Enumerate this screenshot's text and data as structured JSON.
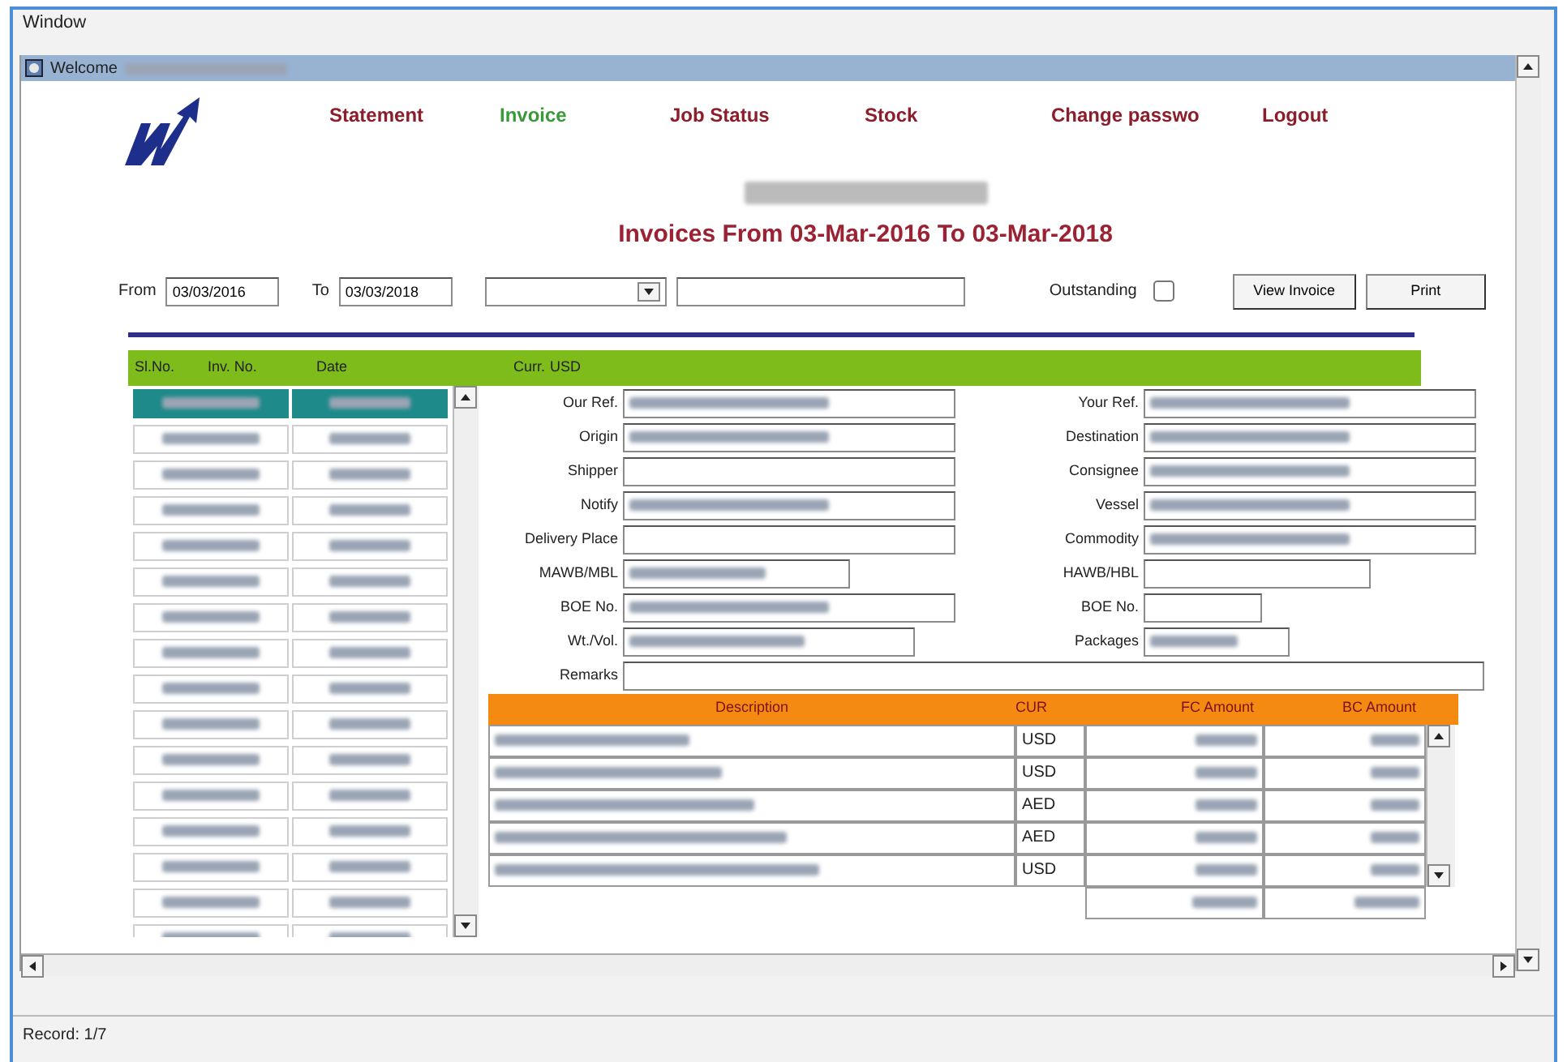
{
  "menu": [
    "Window"
  ],
  "title_bar": {
    "title": "Welcome",
    "redacted": true
  },
  "nav": [
    {
      "label": "Statement",
      "selected": false
    },
    {
      "label": "Invoice",
      "selected": true
    },
    {
      "label": "Job Status",
      "selected": false
    },
    {
      "label": "Stock",
      "selected": false
    },
    {
      "label": "Change passwo",
      "selected": false
    },
    {
      "label": "Logout",
      "selected": false
    }
  ],
  "heading": "Invoices From 03-Mar-2016 To 03-Mar-2018",
  "filters": {
    "from_label": "From",
    "from_value": "03/03/2016",
    "to_label": "To",
    "to_value": "03/03/2018",
    "outstanding_label": "Outstanding",
    "outstanding_checked": false,
    "buttons": [
      "View Invoice",
      "Print"
    ]
  },
  "list_header": {
    "columns": [
      "Sl.No.",
      "Inv. No.",
      "Date"
    ],
    "currency_label": "Curr.",
    "currency_value": "USD"
  },
  "invoice_list": [
    {
      "selected": true
    },
    {
      "selected": false
    },
    {
      "selected": false
    },
    {
      "selected": false
    },
    {
      "selected": false
    },
    {
      "selected": false
    },
    {
      "selected": false
    },
    {
      "selected": false
    },
    {
      "selected": false
    },
    {
      "selected": false
    },
    {
      "selected": false
    },
    {
      "selected": false
    },
    {
      "selected": false
    },
    {
      "selected": false
    },
    {
      "selected": false
    },
    {
      "selected": false
    }
  ],
  "form_left": [
    {
      "label": "Our Ref.",
      "redacted": true
    },
    {
      "label": "Origin",
      "redacted": true
    },
    {
      "label": "Shipper",
      "redacted": false
    },
    {
      "label": "Notify",
      "redacted": true
    },
    {
      "label": "Delivery Place",
      "redacted": false
    },
    {
      "label": "MAWB/MBL",
      "redacted": true
    },
    {
      "label": "BOE No.",
      "redacted": true
    },
    {
      "label": "Wt./Vol.",
      "redacted": true
    }
  ],
  "form_right": [
    {
      "label": "Your Ref.",
      "redacted": true
    },
    {
      "label": "Destination",
      "redacted": true
    },
    {
      "label": "Consignee",
      "redacted": true
    },
    {
      "label": "Vessel",
      "redacted": true
    },
    {
      "label": "Commodity",
      "redacted": true
    },
    {
      "label": "HAWB/HBL",
      "redacted": false
    },
    {
      "label": "BOE No.",
      "redacted": false
    },
    {
      "label": "Packages",
      "redacted": true
    }
  ],
  "remarks_label": "Remarks",
  "line_items": {
    "columns": [
      "Description",
      "CUR",
      "FC Amount",
      "BC Amount"
    ],
    "rows": [
      {
        "cur": "USD"
      },
      {
        "cur": "USD"
      },
      {
        "cur": "AED"
      },
      {
        "cur": "AED"
      },
      {
        "cur": "USD"
      }
    ]
  },
  "status_bar": "Record: 1/7"
}
